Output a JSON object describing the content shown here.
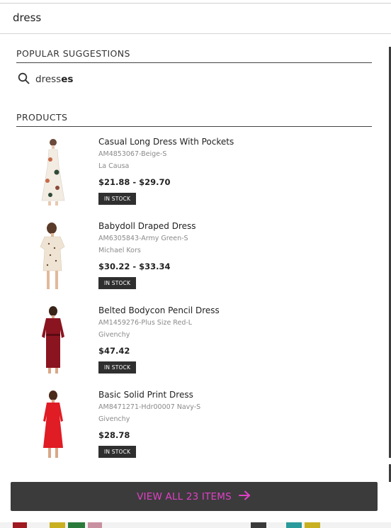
{
  "search": {
    "value": "dress"
  },
  "suggestions": {
    "title": "POPULAR SUGGESTIONS",
    "items": [
      {
        "prefix": "dress",
        "completion": "es"
      }
    ]
  },
  "products": {
    "title": "PRODUCTS",
    "items": [
      {
        "name": "Casual Long Dress With Pockets",
        "sku": "AM4853067-Beige-S",
        "brand": "La Causa",
        "price": "$21.88 - $29.70",
        "stock": "IN STOCK"
      },
      {
        "name": "Babydoll Draped Dress",
        "sku": "AM6305843-Army Green-S",
        "brand": "Michael Kors",
        "price": "$30.22 - $33.34",
        "stock": "IN STOCK"
      },
      {
        "name": "Belted Bodycon Pencil Dress",
        "sku": "AM1459276-Plus Size Red-L",
        "brand": "Givenchy",
        "price": "$47.42",
        "stock": "IN STOCK"
      },
      {
        "name": "Basic Solid Print Dress",
        "sku": "AM8471271-Hdr00007 Navy-S",
        "brand": "Givenchy",
        "price": "$28.78",
        "stock": "IN STOCK"
      }
    ]
  },
  "view_all": {
    "label": "VIEW ALL 23 ITEMS",
    "icon": "arrow-right-icon"
  },
  "colors": {
    "accent": "#e040c8",
    "button_bg": "#3b3b3b",
    "badge_bg": "#2f2f2f"
  }
}
